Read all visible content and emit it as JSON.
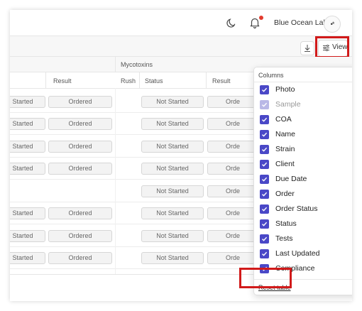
{
  "header": {
    "org_name": "Blue Ocean Labs",
    "avatar_text": "•*",
    "notification_color": "#e23b2e"
  },
  "toolbar": {
    "view_label": "View"
  },
  "table": {
    "group_header": "Mycotoxins",
    "columns": {
      "result_left": "Result",
      "rush": "Rush",
      "status": "Status",
      "result_right": "Result"
    },
    "rows": [
      {
        "left": "Started",
        "result": "Ordered",
        "status": "Not Started",
        "right": "Orde"
      },
      {
        "left": "Started",
        "result": "Ordered",
        "status": "Not Started",
        "right": "Orde"
      },
      {
        "left": "Started",
        "result": "Ordered",
        "status": "Not Started",
        "right": "Orde"
      },
      {
        "left": "Started",
        "result": "Ordered",
        "status": "Not Started",
        "right": "Orde"
      },
      {
        "left": "",
        "result": "",
        "status": "Not Started",
        "right": "Orde"
      },
      {
        "left": "Started",
        "result": "Ordered",
        "status": "Not Started",
        "right": "Orde"
      },
      {
        "left": "Started",
        "result": "Ordered",
        "status": "Not Started",
        "right": "Orde"
      },
      {
        "left": "Started",
        "result": "Ordered",
        "status": "Not Started",
        "right": "Orde"
      }
    ]
  },
  "columns_menu": {
    "title": "Columns",
    "reset_label": "Reset table",
    "accent_color": "#4a48c7",
    "items": [
      {
        "label": "Photo",
        "checked": true,
        "disabled": false
      },
      {
        "label": "Sample",
        "checked": true,
        "disabled": true
      },
      {
        "label": "COA",
        "checked": true,
        "disabled": false
      },
      {
        "label": "Name",
        "checked": true,
        "disabled": false
      },
      {
        "label": "Strain",
        "checked": true,
        "disabled": false
      },
      {
        "label": "Client",
        "checked": true,
        "disabled": false
      },
      {
        "label": "Due Date",
        "checked": true,
        "disabled": false
      },
      {
        "label": "Order",
        "checked": true,
        "disabled": false
      },
      {
        "label": "Order Status",
        "checked": true,
        "disabled": false
      },
      {
        "label": "Status",
        "checked": true,
        "disabled": false
      },
      {
        "label": "Tests",
        "checked": true,
        "disabled": false
      },
      {
        "label": "Last Updated",
        "checked": true,
        "disabled": false
      },
      {
        "label": "Compliance",
        "checked": true,
        "disabled": false
      }
    ]
  },
  "highlight_color": "#d11a1a"
}
